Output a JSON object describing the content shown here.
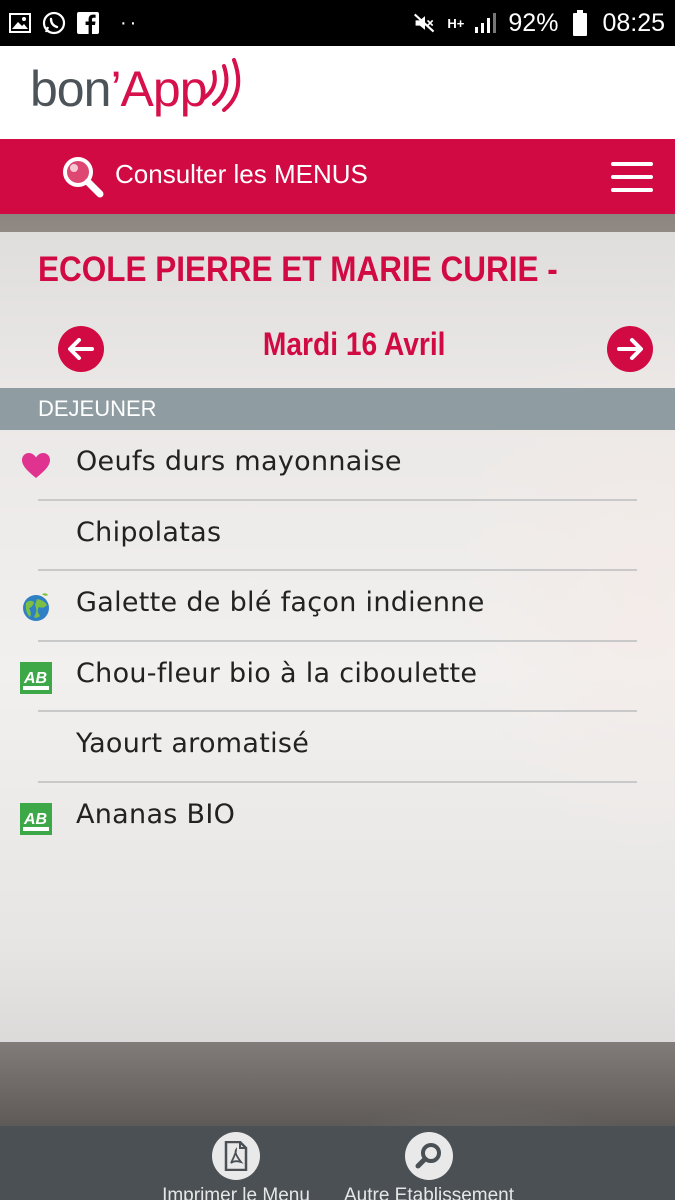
{
  "status_bar": {
    "battery": "92%",
    "time": "08:25",
    "network": "H+",
    "more": "··"
  },
  "brand": {
    "name_part1": "bon",
    "apostrophe": "’",
    "name_part2": "App",
    "colors": {
      "dark": "#4c5459",
      "accent": "#d6104a"
    }
  },
  "nav": {
    "search_label": "Consulter les MENUS",
    "menu_icon": "hamburger-icon"
  },
  "school": {
    "title": "ECOLE PIERRE ET MARIE CURIE -"
  },
  "date": {
    "label": "Mardi 16 Avril",
    "prev_icon": "arrow-left-icon",
    "next_icon": "arrow-right-icon"
  },
  "meal": {
    "title": "DEJEUNER",
    "items": [
      {
        "label": "Oeufs durs mayonnaise",
        "badge": "heart-icon"
      },
      {
        "label": "Chipolatas",
        "badge": ""
      },
      {
        "label": "Galette de blé façon indienne",
        "badge": "globe-icon"
      },
      {
        "label": "Chou-fleur bio à la ciboulette",
        "badge": "organic-ab-icon"
      },
      {
        "label": "Yaourt aromatisé",
        "badge": ""
      },
      {
        "label": "Ananas BIO",
        "badge": "organic-ab-icon"
      }
    ]
  },
  "bottom_bar": {
    "print_label": "Imprimer le Menu",
    "other_label": "Autre Etablissement"
  },
  "colors": {
    "primary_red": "#d20a43",
    "meal_header": "#8f9da3",
    "bottom_bar": "#4a5054"
  }
}
